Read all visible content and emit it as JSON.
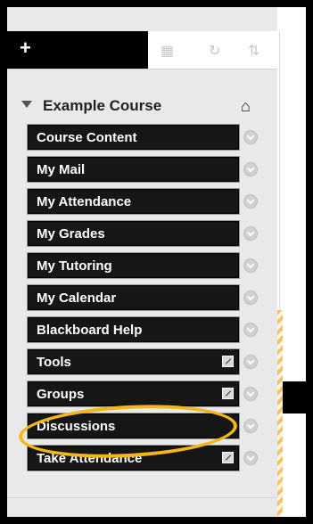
{
  "toolbar": {
    "add_icon_label": "+",
    "icons": [
      "folder-icon",
      "refresh-icon",
      "sort-icon"
    ]
  },
  "course": {
    "title": "Example Course"
  },
  "menu": {
    "items": [
      {
        "label": "Course Content",
        "badge": false
      },
      {
        "label": "My Mail",
        "badge": false
      },
      {
        "label": "My Attendance",
        "badge": false
      },
      {
        "label": "My Grades",
        "badge": false
      },
      {
        "label": "My Tutoring",
        "badge": false
      },
      {
        "label": "My Calendar",
        "badge": false
      },
      {
        "label": "Blackboard Help",
        "badge": false
      },
      {
        "label": "Tools",
        "badge": true
      },
      {
        "label": "Groups",
        "badge": true
      },
      {
        "label": "Discussions",
        "badge": false
      },
      {
        "label": "Take Attendance",
        "badge": true
      }
    ]
  },
  "colors": {
    "highlight": "#f5b718",
    "menu_bg": "#161616"
  }
}
